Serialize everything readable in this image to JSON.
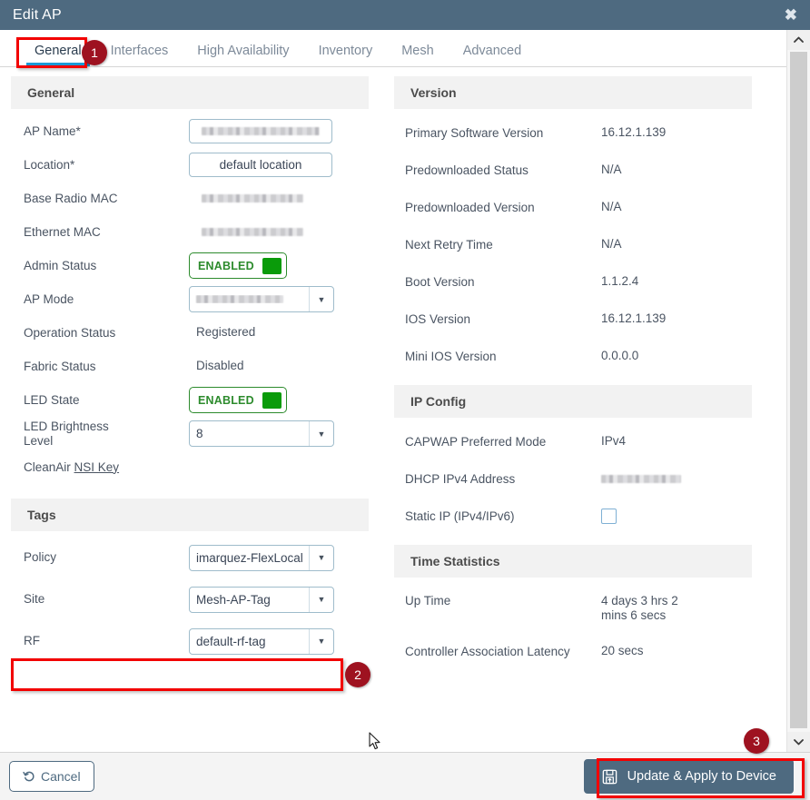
{
  "window": {
    "title": "Edit AP",
    "close_icon": "close-icon",
    "close_glyph": "✖"
  },
  "tabs": [
    {
      "label": "General",
      "active": true
    },
    {
      "label": "Interfaces",
      "active": false
    },
    {
      "label": "High Availability",
      "active": false
    },
    {
      "label": "Inventory",
      "active": false
    },
    {
      "label": "Mesh",
      "active": false
    },
    {
      "label": "Advanced",
      "active": false
    }
  ],
  "left": {
    "general": {
      "header": "General",
      "rows": [
        {
          "label": "AP Name*",
          "type": "input-redacted",
          "value": ""
        },
        {
          "label": "Location*",
          "type": "input",
          "value": "default location"
        },
        {
          "label": "Base Radio MAC",
          "type": "text-redacted",
          "value": ""
        },
        {
          "label": "Ethernet MAC",
          "type": "text-redacted",
          "value": ""
        },
        {
          "label": "Admin Status",
          "type": "toggle",
          "value": "ENABLED"
        },
        {
          "label": "AP Mode",
          "type": "select-redacted",
          "value": ""
        },
        {
          "label": "Operation Status",
          "type": "text",
          "value": "Registered"
        },
        {
          "label": "Fabric Status",
          "type": "text",
          "value": "Disabled"
        },
        {
          "label": "LED State",
          "type": "toggle",
          "value": "ENABLED"
        },
        {
          "label": "LED Brightness Level",
          "type": "select",
          "value": "8"
        },
        {
          "label": "CleanAir ",
          "type": "link",
          "value": "NSI Key"
        }
      ]
    },
    "tags": {
      "header": "Tags",
      "rows": [
        {
          "label": "Policy",
          "type": "select",
          "value": "imarquez-FlexLocal"
        },
        {
          "label": "Site",
          "type": "select",
          "value": "Mesh-AP-Tag"
        },
        {
          "label": "RF",
          "type": "select",
          "value": "default-rf-tag"
        }
      ]
    }
  },
  "right": {
    "version": {
      "header": "Version",
      "rows": [
        {
          "label": "Primary Software Version",
          "value": "16.12.1.139"
        },
        {
          "label": "Predownloaded Status",
          "value": "N/A"
        },
        {
          "label": "Predownloaded Version",
          "value": "N/A"
        },
        {
          "label": "Next Retry Time",
          "value": "N/A"
        },
        {
          "label": "Boot Version",
          "value": "1.1.2.4"
        },
        {
          "label": "IOS Version",
          "value": "16.12.1.139"
        },
        {
          "label": "Mini IOS Version",
          "value": "0.0.0.0"
        }
      ]
    },
    "ip_config": {
      "header": "IP Config",
      "rows": [
        {
          "label": "CAPWAP Preferred Mode",
          "type": "text",
          "value": "IPv4"
        },
        {
          "label": "DHCP IPv4 Address",
          "type": "text-redacted",
          "value": ""
        },
        {
          "label": "Static IP (IPv4/IPv6)",
          "type": "checkbox",
          "value": "",
          "checked": false
        }
      ]
    },
    "time_statistics": {
      "header": "Time Statistics",
      "rows": [
        {
          "label": "Up Time",
          "value": "4 days 3 hrs 2 mins 6 secs"
        },
        {
          "label": "Controller Association Latency",
          "value": "20 secs"
        }
      ]
    }
  },
  "footer": {
    "cancel_label": "Cancel",
    "cancel_icon": "undo-icon",
    "update_label": "Update & Apply to Device",
    "update_icon": "save-icon"
  },
  "annotations": [
    {
      "number": "1",
      "target": "tab-general"
    },
    {
      "number": "2",
      "target": "site-tag-row"
    },
    {
      "number": "3",
      "target": "update-apply-button"
    }
  ],
  "scrollbar": {
    "up_glyph": "^",
    "down_glyph": "v"
  },
  "colors": {
    "titlebar": "#4e6a80",
    "tab_accent": "#1a9ad7",
    "highlight": "#f20000",
    "badge": "#9e1220",
    "toggle_on": "#0a9b0a",
    "primary_button": "#4e6a80"
  }
}
